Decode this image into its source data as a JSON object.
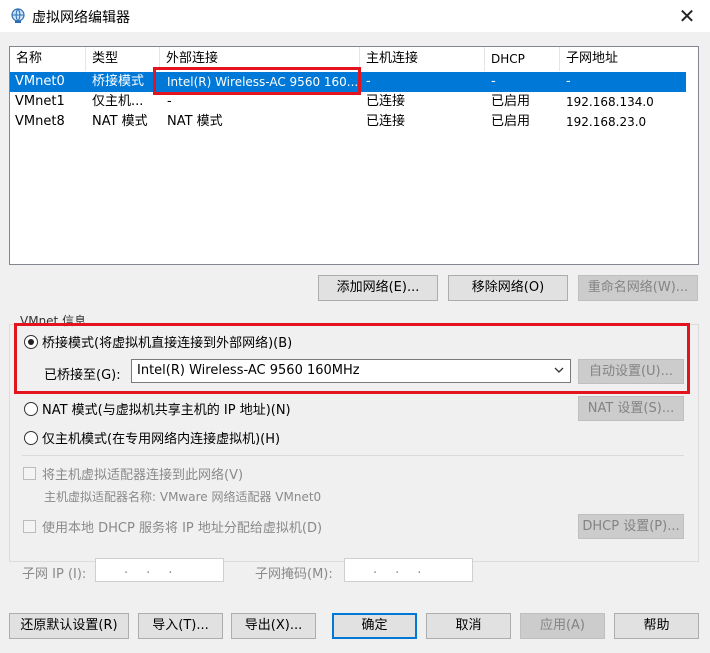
{
  "window": {
    "title": "虚拟网络编辑器",
    "close": "✕"
  },
  "table": {
    "headers": [
      "名称",
      "类型",
      "外部连接",
      "主机连接",
      "DHCP",
      "子网地址"
    ],
    "rows": [
      {
        "name": "VMnet0",
        "type": "桥接模式",
        "external": "Intel(R) Wireless-AC 9560 160...",
        "host": "-",
        "dhcp": "-",
        "subnet": "-",
        "selected": true
      },
      {
        "name": "VMnet1",
        "type": "仅主机...",
        "external": "-",
        "host": "已连接",
        "dhcp": "已启用",
        "subnet": "192.168.134.0",
        "selected": false
      },
      {
        "name": "VMnet8",
        "type": "NAT 模式",
        "external": "NAT 模式",
        "host": "已连接",
        "dhcp": "已启用",
        "subnet": "192.168.23.0",
        "selected": false
      }
    ]
  },
  "list_buttons": {
    "add": "添加网络(E)...",
    "remove": "移除网络(O)",
    "rename": "重命名网络(W)..."
  },
  "vmnet_info": {
    "group_label": "VMnet 信息",
    "bridged_label": "桥接模式(将虚拟机直接连接到外部网络)(B)",
    "bridged_to_label": "已桥接至(G):",
    "bridged_to_value": "Intel(R) Wireless-AC 9560 160MHz",
    "auto_settings": "自动设置(U)...",
    "nat_label": "NAT 模式(与虚拟机共享主机的 IP 地址)(N)",
    "nat_settings": "NAT 设置(S)...",
    "hostonly_label": "仅主机模式(在专用网络内连接虚拟机)(H)",
    "connect_adapter_label": "将主机虚拟适配器连接到此网络(V)",
    "adapter_name_label": "主机虚拟适配器名称: VMware 网络适配器 VMnet0",
    "dhcp_label": "使用本地 DHCP 服务将 IP 地址分配给虚拟机(D)",
    "dhcp_settings": "DHCP 设置(P)...",
    "subnet_ip_label": "子网 IP (I):",
    "subnet_ip_value": "...",
    "subnet_mask_label": "子网掩码(M):",
    "subnet_mask_value": "..."
  },
  "footer": {
    "restore": "还原默认设置(R)",
    "import": "导入(T)...",
    "export": "导出(X)...",
    "ok": "确定",
    "cancel": "取消",
    "apply": "应用(A)",
    "help": "帮助"
  },
  "colors": {
    "selection": "#0078d7",
    "highlight_box": "#e3141d"
  }
}
